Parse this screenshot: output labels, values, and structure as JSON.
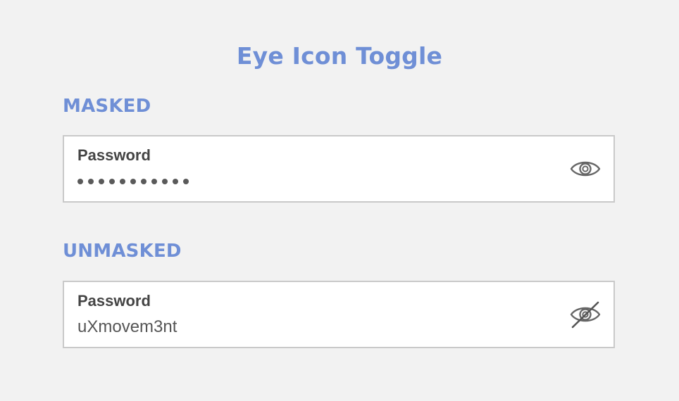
{
  "page": {
    "title": "Eye Icon Toggle"
  },
  "sections": [
    {
      "label": "MASKED",
      "field_label": "Password",
      "masked": true,
      "masked_char_count": 11,
      "icon": "eye-icon"
    },
    {
      "label": "UNMASKED",
      "field_label": "Password",
      "value": "uXmovem3nt",
      "masked": false,
      "icon": "eye-slash-icon"
    }
  ],
  "colors": {
    "accent": "#6f8fd6",
    "background": "#f2f2f2",
    "field_border": "#c9c9c9",
    "text": "#555555"
  }
}
